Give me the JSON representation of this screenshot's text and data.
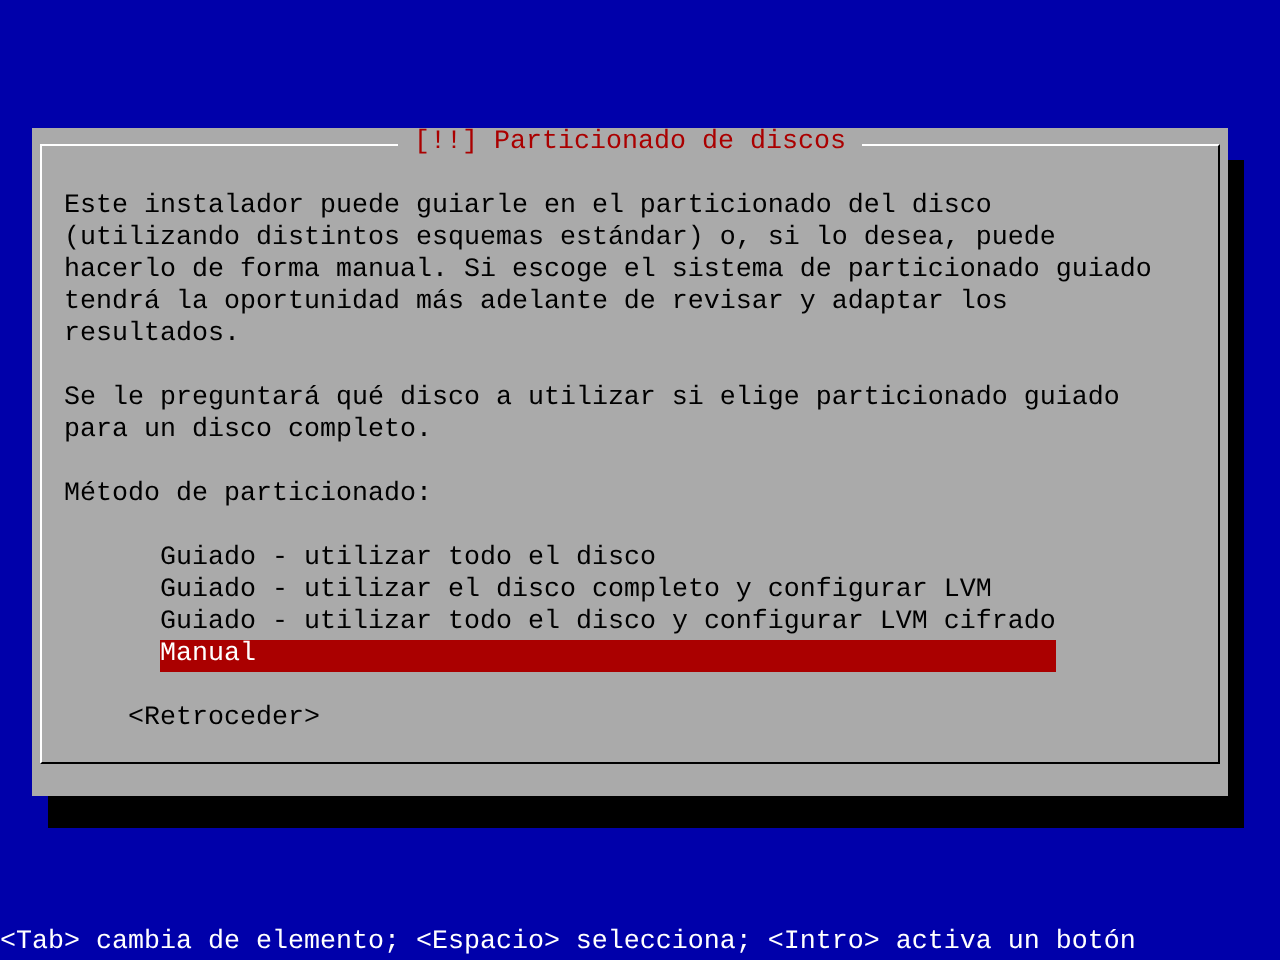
{
  "dialog": {
    "title": "[!!] Particionado de discos",
    "paragraphs": [
      "Este instalador puede guiarle en el particionado del disco\n(utilizando distintos esquemas estándar) o, si lo desea, puede\nhacerlo de forma manual. Si escoge el sistema de particionado guiado\ntendrá la oportunidad más adelante de revisar y adaptar los\nresultados.",
      "Se le preguntará qué disco a utilizar si elige particionado guiado\npara un disco completo."
    ],
    "prompt": "Método de particionado:",
    "options": [
      {
        "label": "Guiado - utilizar todo el disco",
        "selected": false
      },
      {
        "label": "Guiado - utilizar el disco completo y configurar LVM",
        "selected": false
      },
      {
        "label": "Guiado - utilizar todo el disco y configurar LVM cifrado",
        "selected": false
      },
      {
        "label": "Manual",
        "selected": true
      }
    ],
    "buttons": [
      {
        "label": "<Retroceder>",
        "selected": false
      }
    ]
  },
  "status_bar": "<Tab> cambia de elemento; <Espacio> selecciona; <Intro> activa un botón"
}
